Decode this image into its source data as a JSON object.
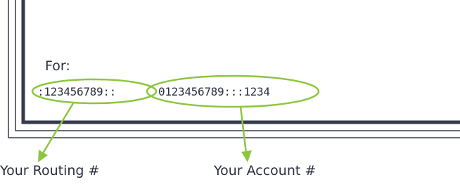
{
  "check": {
    "for_label": "For:",
    "routing_number": ":123456789::",
    "account_number": "0123456789:::1234"
  },
  "callouts": {
    "routing_label": "Your Routing #",
    "account_label": "Your Account #"
  },
  "colors": {
    "border_dark": "#363a4f",
    "text": "#2b2e3f",
    "highlight_green": "#8dc63f"
  }
}
